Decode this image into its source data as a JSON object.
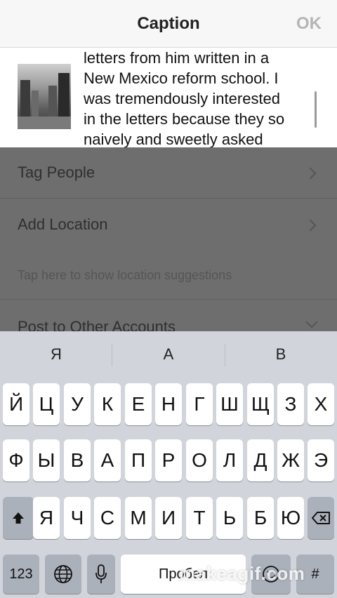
{
  "header": {
    "title": "Caption",
    "ok_label": "OK"
  },
  "caption": {
    "thumbnail_icon": "photo-thumbnail",
    "lines": [
      "letters from him written in a",
      "New Mexico reform school. I",
      "was tremendously interested",
      "in the letters because they so",
      "naively and sweetly asked"
    ]
  },
  "options": {
    "tag_people": "Tag People",
    "add_location": "Add Location",
    "location_hint": "Tap here to show location suggestions",
    "post_other": "Post to Other Accounts"
  },
  "keyboard": {
    "predictions": [
      "Я",
      "А",
      "В"
    ],
    "row1": [
      "Й",
      "Ц",
      "У",
      "К",
      "Е",
      "Н",
      "Г",
      "Ш",
      "Щ",
      "З",
      "Х"
    ],
    "row2": [
      "Ф",
      "Ы",
      "В",
      "А",
      "П",
      "Р",
      "О",
      "Л",
      "Д",
      "Ж",
      "Э"
    ],
    "row3": [
      "Я",
      "Ч",
      "С",
      "М",
      "И",
      "Т",
      "Ь",
      "Б",
      "Ю"
    ],
    "numbers_label": "123",
    "space_label": "Пробел",
    "return_label": "#"
  },
  "watermark": "makeagif.com",
  "colors": {
    "overlay": "#6e6e6e",
    "keyboard_bg": "#d1d4da",
    "ok_disabled": "#b5b5b5"
  }
}
